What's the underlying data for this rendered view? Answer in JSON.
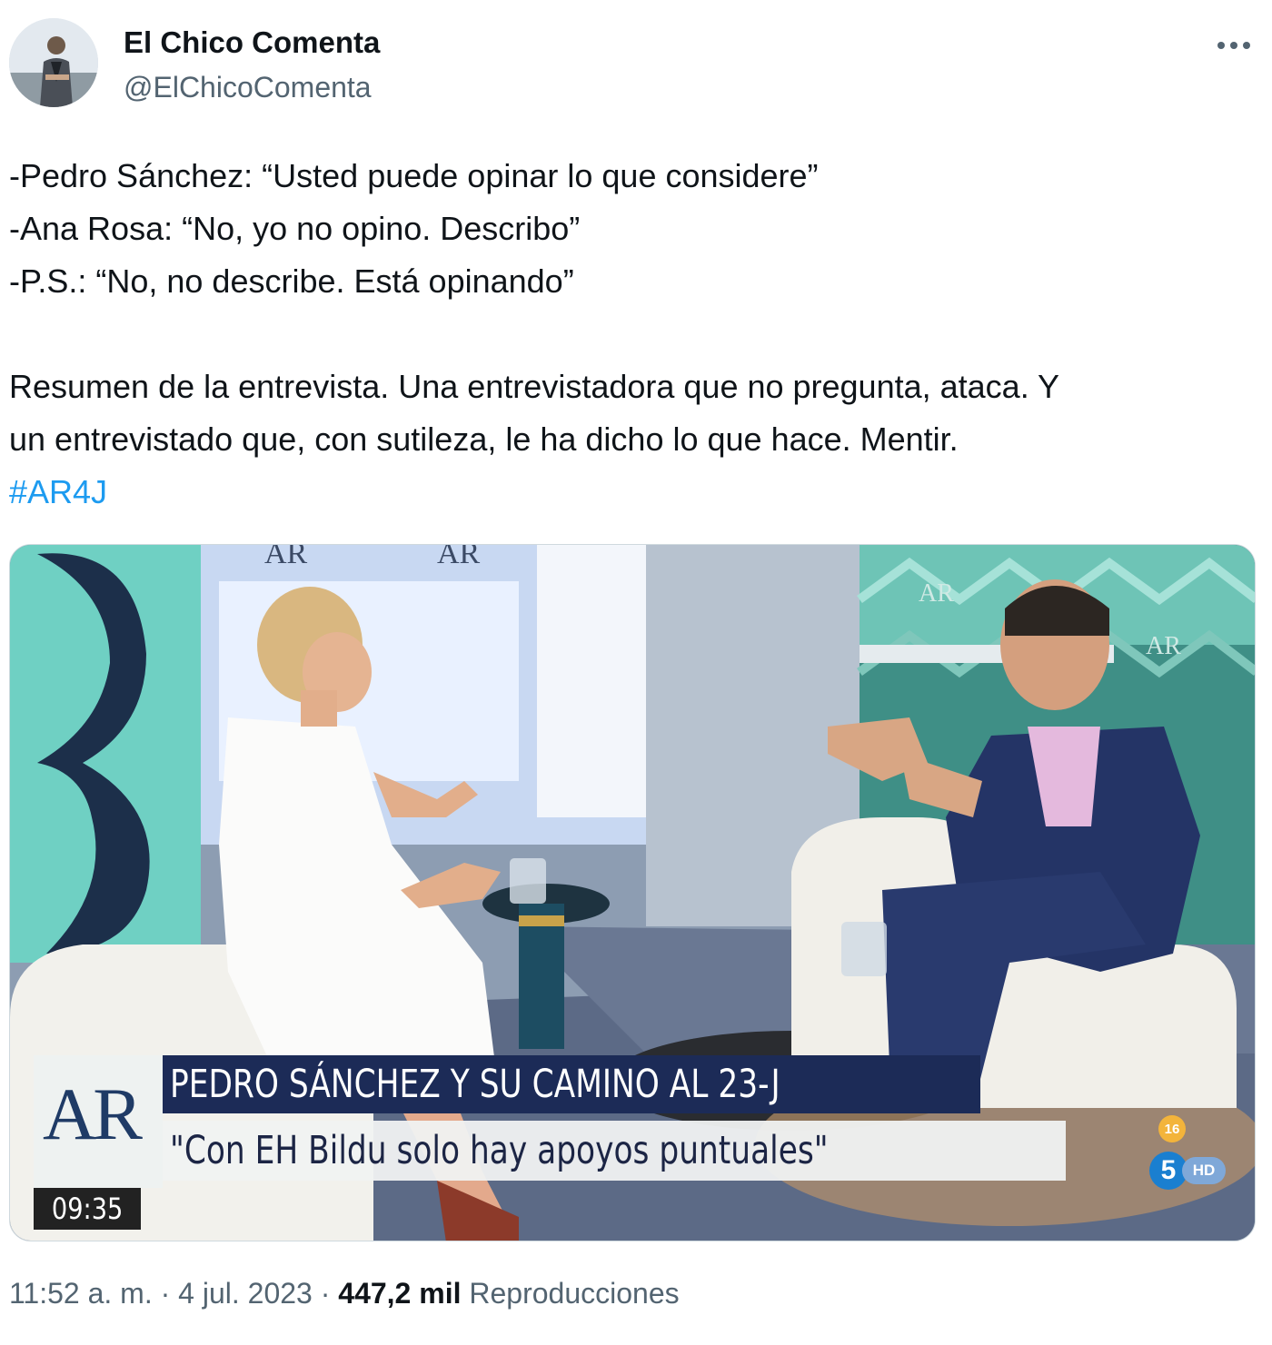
{
  "author": {
    "name": "El Chico Comenta",
    "handle": "@ElChicoComenta"
  },
  "tweet": {
    "lines": [
      "-Pedro Sánchez: “Usted puede opinar lo que considere”",
      "-Ana Rosa: “No, yo no opino. Describo”",
      "-P.S.: “No, no describe. Está opinando”",
      "Resumen de la entrevista. Una entrevistadora que no pregunta, ataca. Y",
      "un entrevistado que, con sutileza, le ha dicho lo que hace. Mentir."
    ],
    "hashtag": "#AR4J"
  },
  "video": {
    "logo": "AR",
    "headline": "PEDRO SÁNCHEZ Y SU CAMINO AL 23-J",
    "subheadline": "\"Con EH Bildu solo hay apoyos puntuales\"",
    "clock": "09:35",
    "age_rating": "16",
    "channel": "5",
    "channel_hd": "HD"
  },
  "footer": {
    "time": "11:52 a. m.",
    "separator": "·",
    "date": "4 jul. 2023",
    "views_count": "447,2 mil",
    "views_label": "Reproducciones"
  },
  "icons": {
    "more": "more-horizontal-icon"
  },
  "colors": {
    "text": "#0f1419",
    "secondary": "#536471",
    "link": "#1d9bf0",
    "headline_bar": "#1c2b57"
  }
}
